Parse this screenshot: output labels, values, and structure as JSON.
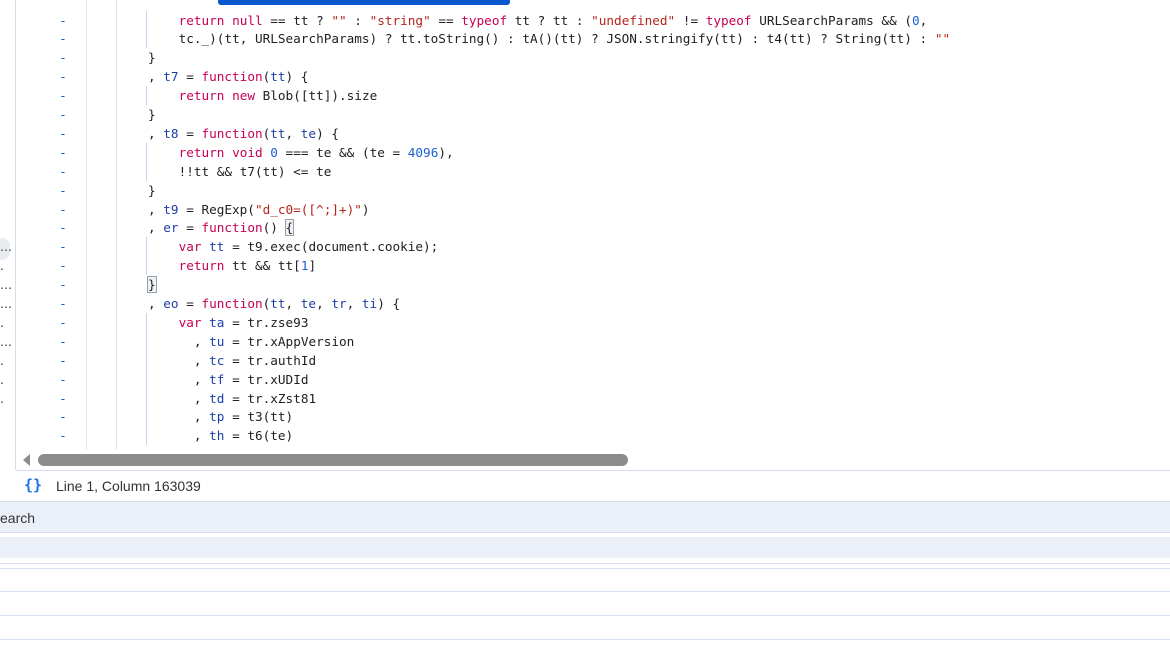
{
  "editor": {
    "lines": [
      {
        "indent": 4,
        "tokens": [
          [
            "k",
            "return"
          ],
          [
            "p",
            " "
          ],
          [
            "k",
            "null"
          ],
          [
            "p",
            " == tt ? "
          ],
          [
            "s",
            "\"\""
          ],
          [
            "p",
            " : "
          ],
          [
            "s",
            "\"string\""
          ],
          [
            "p",
            " == "
          ],
          [
            "k",
            "typeof"
          ],
          [
            "p",
            " tt ? tt : "
          ],
          [
            "s",
            "\"undefined\""
          ],
          [
            "p",
            " != "
          ],
          [
            "k",
            "typeof"
          ],
          [
            "p",
            " URLSearchParams && ("
          ],
          [
            "n",
            "0"
          ],
          [
            "p",
            ","
          ]
        ]
      },
      {
        "indent": 4,
        "tokens": [
          [
            "p",
            "tc._)(tt, URLSearchParams) ? tt.toString() : tA()(tt) ? JSON.stringify(tt) : t4(tt) ? String(tt) : "
          ],
          [
            "s",
            "\"\""
          ]
        ]
      },
      {
        "indent": 0,
        "tokens": [
          [
            "p",
            "}"
          ]
        ]
      },
      {
        "indent": 0,
        "tokens": [
          [
            "p",
            ", "
          ],
          [
            "d",
            "t7"
          ],
          [
            "p",
            " = "
          ],
          [
            "k",
            "function"
          ],
          [
            "p",
            "("
          ],
          [
            "d",
            "tt"
          ],
          [
            "p",
            ") {"
          ]
        ]
      },
      {
        "indent": 4,
        "tokens": [
          [
            "k",
            "return"
          ],
          [
            "p",
            " "
          ],
          [
            "k",
            "new"
          ],
          [
            "p",
            " Blob([tt]).size"
          ]
        ]
      },
      {
        "indent": 0,
        "tokens": [
          [
            "p",
            "}"
          ]
        ]
      },
      {
        "indent": 0,
        "tokens": [
          [
            "p",
            ", "
          ],
          [
            "d",
            "t8"
          ],
          [
            "p",
            " = "
          ],
          [
            "k",
            "function"
          ],
          [
            "p",
            "("
          ],
          [
            "d",
            "tt"
          ],
          [
            "p",
            ", "
          ],
          [
            "d",
            "te"
          ],
          [
            "p",
            ") {"
          ]
        ]
      },
      {
        "indent": 4,
        "tokens": [
          [
            "k",
            "return"
          ],
          [
            "p",
            " "
          ],
          [
            "k",
            "void"
          ],
          [
            "p",
            " "
          ],
          [
            "n",
            "0"
          ],
          [
            "p",
            " === te && (te = "
          ],
          [
            "n",
            "4096"
          ],
          [
            "p",
            "),"
          ]
        ]
      },
      {
        "indent": 4,
        "tokens": [
          [
            "p",
            "!!tt && t7(tt) <= te"
          ]
        ]
      },
      {
        "indent": 0,
        "tokens": [
          [
            "p",
            "}"
          ]
        ]
      },
      {
        "indent": 0,
        "tokens": [
          [
            "p",
            ", "
          ],
          [
            "d",
            "t9"
          ],
          [
            "p",
            " = RegExp("
          ],
          [
            "s",
            "\"d_c0=([^;]+)\""
          ],
          [
            "p",
            ")"
          ]
        ]
      },
      {
        "indent": 0,
        "tokens": [
          [
            "p",
            ", "
          ],
          [
            "d",
            "er"
          ],
          [
            "p",
            " = "
          ],
          [
            "k",
            "function"
          ],
          [
            "p",
            "() "
          ],
          [
            "h",
            "{"
          ]
        ]
      },
      {
        "indent": 4,
        "tokens": [
          [
            "k",
            "var"
          ],
          [
            "p",
            " "
          ],
          [
            "d",
            "tt"
          ],
          [
            "p",
            " = t9.exec(document.cookie);"
          ]
        ]
      },
      {
        "indent": 4,
        "tokens": [
          [
            "k",
            "return"
          ],
          [
            "p",
            " tt && tt["
          ],
          [
            "n",
            "1"
          ],
          [
            "p",
            "]"
          ]
        ]
      },
      {
        "indent": 0,
        "tokens": [
          [
            "h",
            "}"
          ]
        ]
      },
      {
        "indent": 0,
        "tokens": [
          [
            "p",
            ", "
          ],
          [
            "d",
            "eo"
          ],
          [
            "p",
            " = "
          ],
          [
            "k",
            "function"
          ],
          [
            "p",
            "("
          ],
          [
            "d",
            "tt"
          ],
          [
            "p",
            ", "
          ],
          [
            "d",
            "te"
          ],
          [
            "p",
            ", "
          ],
          [
            "d",
            "tr"
          ],
          [
            "p",
            ", "
          ],
          [
            "d",
            "ti"
          ],
          [
            "p",
            ") {"
          ]
        ]
      },
      {
        "indent": 4,
        "tokens": [
          [
            "k",
            "var"
          ],
          [
            "p",
            " "
          ],
          [
            "d",
            "ta"
          ],
          [
            "p",
            " = tr.zse93"
          ]
        ]
      },
      {
        "indent": 6,
        "tokens": [
          [
            "p",
            ", "
          ],
          [
            "d",
            "tu"
          ],
          [
            "p",
            " = tr.xAppVersion"
          ]
        ]
      },
      {
        "indent": 6,
        "tokens": [
          [
            "p",
            ", "
          ],
          [
            "d",
            "tc"
          ],
          [
            "p",
            " = tr.authId"
          ]
        ]
      },
      {
        "indent": 6,
        "tokens": [
          [
            "p",
            ", "
          ],
          [
            "d",
            "tf"
          ],
          [
            "p",
            " = tr.xUDId"
          ]
        ]
      },
      {
        "indent": 6,
        "tokens": [
          [
            "p",
            ", "
          ],
          [
            "d",
            "td"
          ],
          [
            "p",
            " = tr.xZst81"
          ]
        ]
      },
      {
        "indent": 6,
        "tokens": [
          [
            "p",
            ", "
          ],
          [
            "d",
            "tp"
          ],
          [
            "p",
            " = t3(tt)"
          ]
        ]
      },
      {
        "indent": 6,
        "tokens": [
          [
            "p",
            ", "
          ],
          [
            "d",
            "th"
          ],
          [
            "p",
            " = t6(te)"
          ]
        ]
      }
    ],
    "diff_marker": "-"
  },
  "status_bar": {
    "format_icon": "{}",
    "cursor_position": "Line 1, Column 163039"
  },
  "drawer": {
    "tab_label": "earch"
  },
  "sidebar": {
    "truncated_markers": [
      "…",
      ".",
      "…",
      "…",
      ".",
      "…",
      ".",
      ".",
      "."
    ]
  },
  "colors": {
    "keyword": "#c80054",
    "string": "#b3261e",
    "number": "#1a5fd6",
    "definition": "#1c3ea8",
    "accent": "#0b57d0"
  }
}
